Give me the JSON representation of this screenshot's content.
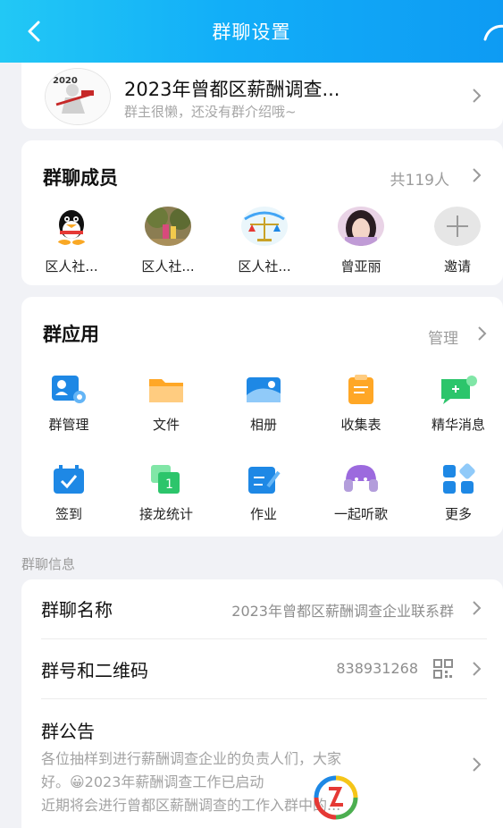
{
  "header": {
    "title": "群聊设置"
  },
  "group": {
    "name": "2023年曾都区薪酬调查...",
    "intro": "群主很懒，还没有群介绍哦~",
    "avatar_text": "2020"
  },
  "members": {
    "title": "群聊成员",
    "count": "共119人",
    "list": [
      {
        "name": "区人社...",
        "avatar": "qq-penguin-icon"
      },
      {
        "name": "区人社...",
        "avatar": "photo-avatar"
      },
      {
        "name": "区人社...",
        "avatar": "scale-logo-avatar"
      },
      {
        "name": "曾亚丽",
        "avatar": "photo-avatar"
      },
      {
        "name": "邀请",
        "avatar": "plus-icon"
      }
    ]
  },
  "apps": {
    "title": "群应用",
    "manage": "管理",
    "items": [
      {
        "label": "群管理",
        "icon": "group-manage-icon"
      },
      {
        "label": "文件",
        "icon": "folder-icon"
      },
      {
        "label": "相册",
        "icon": "album-icon"
      },
      {
        "label": "收集表",
        "icon": "form-icon"
      },
      {
        "label": "精华消息",
        "icon": "essence-message-icon"
      },
      {
        "label": "签到",
        "icon": "checkin-icon"
      },
      {
        "label": "接龙统计",
        "icon": "relay-icon"
      },
      {
        "label": "作业",
        "icon": "homework-icon"
      },
      {
        "label": "一起听歌",
        "icon": "music-icon"
      },
      {
        "label": "更多",
        "icon": "more-apps-icon"
      }
    ]
  },
  "info": {
    "section_label": "群聊信息",
    "name_label": "群聊名称",
    "name_value": "2023年曾都区薪酬调查企业联系群",
    "id_label": "群号和二维码",
    "id_value": "838931268",
    "notice_label": "群公告",
    "notice_line1": "各位抽样到进行薪酬调查企业的负责人们，大家",
    "notice_line2": "好。😀2023年薪酬调查工作已启动",
    "notice_line3": "近期将会进行曾都区薪酬调查的工作入群中的..."
  },
  "colors": {
    "header_start": "#22c8f5",
    "header_end": "#0e9bf3",
    "app_blue": "#1e88e5",
    "app_orange": "#ffa726",
    "app_green": "#2cc56b"
  }
}
